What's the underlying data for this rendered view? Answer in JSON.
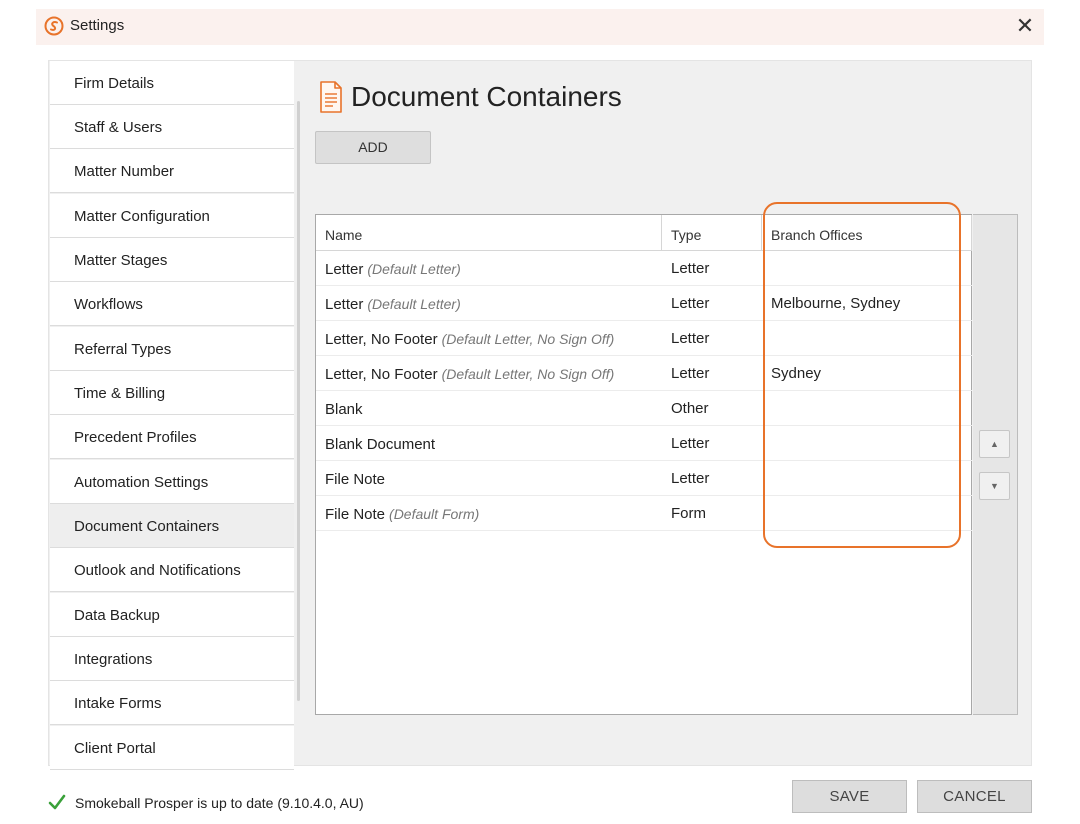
{
  "window": {
    "title": "Settings",
    "close_glyph": "✕"
  },
  "sidebar": {
    "items": [
      {
        "label": "Firm Details"
      },
      {
        "label": "Staff & Users"
      },
      {
        "label": "Matter Number"
      },
      {
        "label": "Matter Configuration"
      },
      {
        "label": "Matter Stages"
      },
      {
        "label": "Workflows"
      },
      {
        "label": "Referral Types"
      },
      {
        "label": "Time & Billing"
      },
      {
        "label": "Precedent Profiles"
      },
      {
        "label": "Automation Settings"
      },
      {
        "label": "Document Containers",
        "active": true
      },
      {
        "label": "Outlook and Notifications"
      },
      {
        "label": "Data Backup"
      },
      {
        "label": "Integrations"
      },
      {
        "label": "Intake Forms"
      },
      {
        "label": "Client Portal"
      }
    ]
  },
  "main": {
    "title": "Document Containers",
    "add_label": "ADD",
    "table": {
      "headers": {
        "name": "Name",
        "type": "Type",
        "branch": "Branch Offices"
      },
      "rows": [
        {
          "name": "Letter",
          "sub": "(Default Letter)",
          "type": "Letter",
          "branch": ""
        },
        {
          "name": "Letter",
          "sub": "(Default Letter)",
          "type": "Letter",
          "branch": "Melbourne, Sydney"
        },
        {
          "name": "Letter, No Footer",
          "sub": "(Default Letter, No Sign Off)",
          "type": "Letter",
          "branch": ""
        },
        {
          "name": "Letter, No Footer",
          "sub": "(Default Letter, No Sign Off)",
          "type": "Letter",
          "branch": "Sydney"
        },
        {
          "name": "Blank",
          "sub": "",
          "type": "Other",
          "branch": ""
        },
        {
          "name": "Blank Document",
          "sub": "",
          "type": "Letter",
          "branch": ""
        },
        {
          "name": "File Note",
          "sub": "",
          "type": "Letter",
          "branch": ""
        },
        {
          "name": "File Note",
          "sub": "(Default Form)",
          "type": "Form",
          "branch": ""
        }
      ]
    },
    "move_up_glyph": "▲",
    "move_down_glyph": "▼"
  },
  "footer": {
    "status": "Smokeball Prosper is up to date (9.10.4.0, AU)",
    "save_label": "SAVE",
    "cancel_label": "CANCEL"
  },
  "colors": {
    "accent": "#e8732a",
    "check": "#3aa13a",
    "titlebar_bg": "#fbf1ee"
  },
  "icons": {
    "logo": "smokeball-logo-icon",
    "page": "document-icon",
    "status": "checkmark-icon"
  }
}
